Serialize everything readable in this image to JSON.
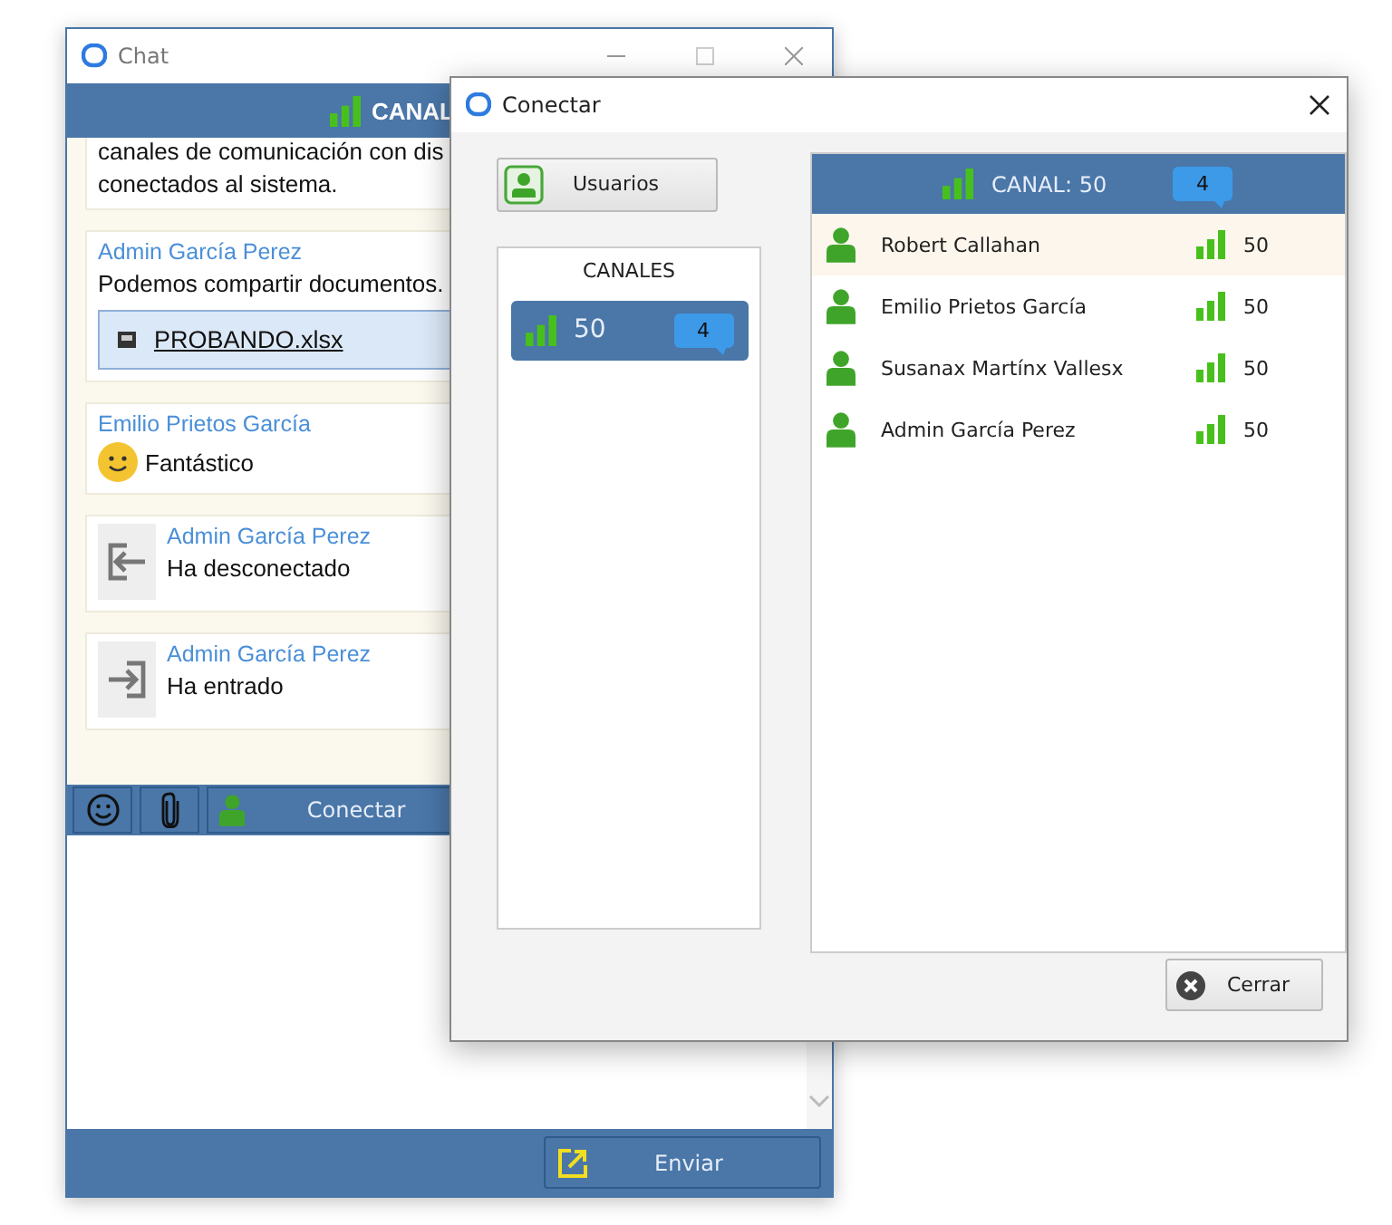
{
  "chat_window": {
    "title": "Chat",
    "header": {
      "label": "CANAL"
    },
    "messages": [
      {
        "kind": "text",
        "lines": [
          "canales de comunicación con dis",
          "conectados al sistema."
        ]
      },
      {
        "kind": "file",
        "author": "Admin García Perez",
        "text": "Podemos compartir documentos.",
        "file": "PROBANDO.xlsx"
      },
      {
        "kind": "emoji",
        "author": "Emilio Prietos García",
        "text": "Fantástico"
      },
      {
        "kind": "leave",
        "author": "Admin García Perez",
        "text": "Ha desconectado"
      },
      {
        "kind": "join",
        "author": "Admin García Perez",
        "text": "Ha entrado"
      }
    ],
    "connect_button": "Conectar",
    "send_button": "Enviar"
  },
  "dialog": {
    "title": "Conectar",
    "users_button": "Usuarios",
    "channels_heading": "CANALES",
    "channels": [
      {
        "name": "50",
        "count": "4",
        "selected": true
      }
    ],
    "channel_header": {
      "label": "CANAL: 50",
      "count": "4"
    },
    "users": [
      {
        "name": "Robert Callahan",
        "signal": "50",
        "selected": true
      },
      {
        "name": "Emilio Prietos García",
        "signal": "50",
        "selected": false
      },
      {
        "name": "Susanax Martínx Vallesx",
        "signal": "50",
        "selected": false
      },
      {
        "name": "Admin García Perez",
        "signal": "50",
        "selected": false
      }
    ],
    "close_button": "Cerrar"
  }
}
